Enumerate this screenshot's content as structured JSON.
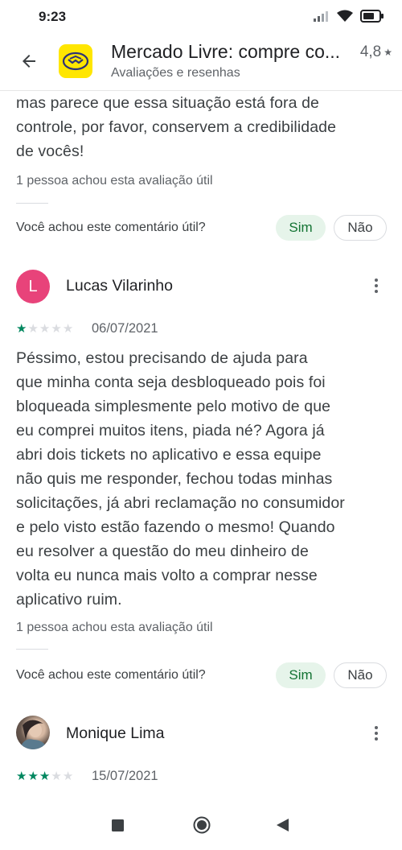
{
  "status_bar": {
    "time": "9:23"
  },
  "header": {
    "app_title": "Mercado Livre: compre co...",
    "subtitle": "Avaliações e resenhas",
    "rating": "4,8",
    "rating_star": "★"
  },
  "previous_review": {
    "text_lines": [
      "mas parece que essa situação está fora de",
      "controle, por favor, conservem a credibilidade",
      "de vocês!"
    ],
    "helpful_count": "1 pessoa achou esta avaliação útil",
    "question": "Você achou este comentário útil?",
    "yes_label": "Sim",
    "no_label": "Não"
  },
  "review_1": {
    "avatar_letter": "L",
    "avatar_color": "#e8437a",
    "name": "Lucas Vilarinho",
    "stars": 1,
    "date": "06/07/2021",
    "text_lines": [
      "Péssimo, estou precisando de ajuda para",
      "que minha conta seja desbloqueado pois foi",
      "bloqueada simplesmente pelo motivo de que",
      "eu comprei muitos itens, piada né? Agora já",
      "abri dois tickets no aplicativo e essa equipe",
      "não quis me responder, fechou todas minhas",
      "solicitações, já abri reclamação no consumidor",
      "e pelo visto estão fazendo o mesmo! Quando",
      "eu resolver a questão do meu dinheiro de",
      "volta eu nunca mais volto a comprar nesse",
      "aplicativo ruim."
    ],
    "helpful_count": "1 pessoa achou esta avaliação útil",
    "question": "Você achou este comentário útil?",
    "yes_label": "Sim",
    "no_label": "Não"
  },
  "review_2": {
    "name": "Monique Lima",
    "stars": 3,
    "date": "15/07/2021"
  },
  "colors": {
    "star_on": "#01875f",
    "star_off": "#dadce0",
    "yes_bg": "#e6f4ea",
    "yes_text": "#137333",
    "logo_bg": "#FFE600"
  }
}
